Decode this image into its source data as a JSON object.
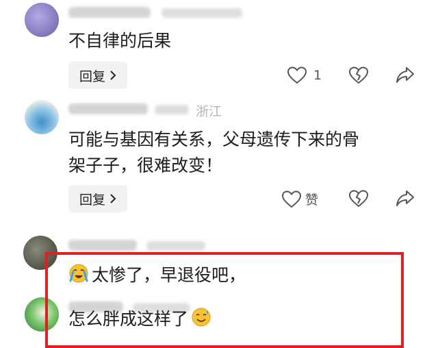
{
  "comments": [
    {
      "text": "不自律的后果",
      "reply_label": "回复",
      "like_count": "1",
      "avatar_color": "#6a5fa8"
    },
    {
      "text_line1": "可能与基因有关系，父母遗传下来的骨",
      "text_line2": "架子子，很难改变！",
      "region": "浙江",
      "reply_label": "回复",
      "like_label": "赞",
      "avatar_color": "#7fb6d8"
    },
    {
      "text": "太惨了，早退役吧，",
      "emoji": "crying-face-icon",
      "avatar_color": "#5a5a4a"
    },
    {
      "text": "怎么胖成这样了",
      "emoji": "grinning-sweat-face-icon",
      "avatar_color": "#3f9a4c"
    }
  ],
  "colors": {
    "highlight_border": "#e02020",
    "reply_bg": "#f2f2f2"
  }
}
